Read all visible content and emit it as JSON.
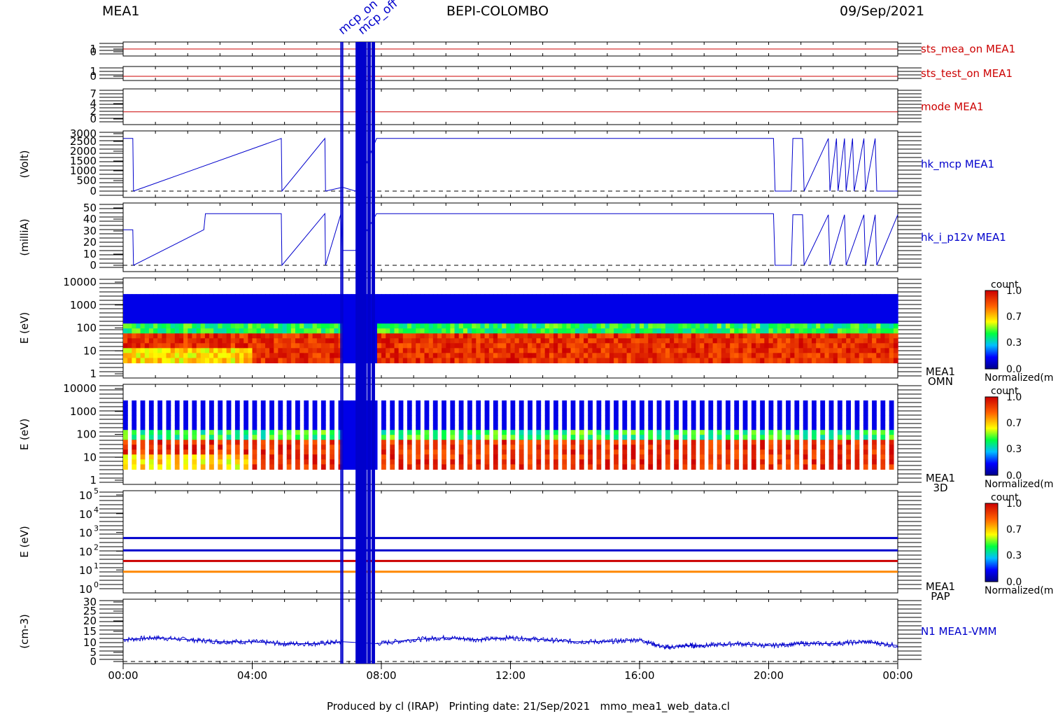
{
  "header": {
    "left": "MEA1",
    "center": "BEPI-COLOMBO",
    "right": "09/Sep/2021"
  },
  "footer": "Produced by cl (IRAP)   Printing date: 21/Sep/2021   mmo_mea1_web_data.cl",
  "colors": {
    "red": "#cc0000",
    "blue": "#0000cc",
    "black": "#000000"
  },
  "event_labels": [
    "mcp_on",
    "mcp_off"
  ],
  "time_axis": {
    "start_hour": 0,
    "end_hour": 24,
    "ticks": [
      "00:00",
      "04:00",
      "08:00",
      "12:00",
      "16:00",
      "20:00",
      "00:00"
    ]
  },
  "colorbar": {
    "title": "count",
    "ticks": [
      "1.0",
      "0.7",
      "0.3",
      "0.0"
    ],
    "label": "Normalized(m"
  },
  "chart_data": [
    {
      "type": "line",
      "name": "sts_mea_on MEA1",
      "ylim": [
        0,
        1
      ],
      "yticks": [
        "1",
        "0"
      ],
      "series": [
        {
          "name": "sts_mea_on MEA1",
          "x": [
            0,
            24
          ],
          "y": [
            1,
            1
          ]
        }
      ]
    },
    {
      "type": "line",
      "name": "sts_test_on MEA1",
      "ylim": [
        0,
        1
      ],
      "yticks": [
        "1",
        "0"
      ],
      "series": [
        {
          "name": "sts_test_on MEA1",
          "x": [
            0,
            24
          ],
          "y": [
            0,
            0
          ]
        }
      ]
    },
    {
      "type": "line",
      "name": "mode MEA1",
      "ylim": [
        0,
        7
      ],
      "yticks": [
        "7",
        "4",
        "2",
        "0"
      ],
      "series": [
        {
          "name": "mode MEA1",
          "x": [
            0,
            24
          ],
          "y": [
            2,
            2
          ]
        }
      ]
    },
    {
      "type": "line",
      "name": "hk_mcp MEA1",
      "ylabel": "(Volt)",
      "ylim": [
        0,
        3000
      ],
      "yticks": [
        "3000",
        "2500",
        "2000",
        "1500",
        "1000",
        "500",
        "0"
      ],
      "series": [
        {
          "name": "hk_mcp MEA1",
          "x": [
            0,
            0.3,
            0.32,
            4.9,
            4.92,
            6.25,
            6.27,
            6.8,
            7.2,
            7.85,
            20.15,
            20.2,
            20.7,
            20.75,
            21.05,
            21.1,
            21.85,
            21.9,
            22.1,
            22.15,
            22.35,
            22.4,
            22.6,
            22.65,
            22.95,
            23.0,
            23.3,
            23.35,
            24
          ],
          "y": [
            2750,
            2750,
            0,
            2750,
            0,
            2750,
            0,
            200,
            0,
            2750,
            2750,
            0,
            0,
            2750,
            2750,
            0,
            2750,
            0,
            2750,
            0,
            2750,
            0,
            2750,
            0,
            2750,
            0,
            2750,
            0,
            0
          ]
        }
      ]
    },
    {
      "type": "line",
      "name": "hk_i_p12v MEA1",
      "ylabel": "(milliA)",
      "ylim": [
        0,
        50
      ],
      "yticks": [
        "50",
        "40",
        "30",
        "20",
        "10",
        "0"
      ],
      "series": [
        {
          "name": "hk_i_p12v MEA1",
          "x": [
            0,
            0.3,
            0.32,
            2.5,
            2.55,
            4.9,
            4.92,
            6.25,
            6.27,
            6.75,
            6.8,
            7.2,
            7.85,
            20.15,
            20.2,
            20.7,
            20.75,
            21.05,
            21.1,
            21.85,
            21.9,
            22.35,
            22.4,
            22.95,
            23.0,
            23.3,
            23.35,
            24
          ],
          "y": [
            31,
            31,
            0,
            31,
            45,
            45,
            0,
            45,
            0,
            45,
            13,
            13,
            45,
            45,
            0,
            0,
            44,
            44,
            0,
            44,
            0,
            44,
            0,
            44,
            0,
            44,
            0,
            44
          ]
        }
      ]
    },
    {
      "type": "heatmap",
      "name": "MEA1 OMN",
      "ylabel": "E (eV)",
      "ylim": [
        1,
        10000
      ],
      "yticks": [
        "10000",
        "1000",
        "100",
        "10",
        "1"
      ],
      "label_lines": [
        "MEA1",
        "OMN"
      ],
      "erange": [
        3,
        3000
      ]
    },
    {
      "type": "heatmap",
      "name": "MEA1 3D",
      "ylabel": "E (eV)",
      "ylim": [
        1,
        10000
      ],
      "yticks": [
        "10000",
        "1000",
        "100",
        "10",
        "1"
      ],
      "label_lines": [
        "MEA1",
        "3D"
      ],
      "erange": [
        3,
        3000
      ]
    },
    {
      "type": "heatmap",
      "name": "MEA1 PAP",
      "ylabel": "E (eV)",
      "ylim": [
        1,
        100000
      ],
      "yticks": [
        "5",
        "4",
        "3",
        "2",
        "1",
        "0"
      ],
      "label_lines": [
        "MEA1",
        "PAP"
      ],
      "energy_lines": [
        500,
        110,
        30,
        8
      ]
    },
    {
      "type": "line",
      "name": "N1 MEA1-VMM",
      "ylabel": "(cm-3)",
      "ylim": [
        0,
        30
      ],
      "yticks": [
        "30",
        "25",
        "20",
        "15",
        "10",
        "5",
        "0"
      ],
      "series": [
        {
          "name": "N1 MEA1-VMM",
          "x": [
            0,
            1,
            2,
            3,
            4,
            5,
            6,
            6.8,
            7.85,
            9,
            10,
            11,
            12,
            13,
            14,
            15,
            16,
            16.8,
            17.5,
            18,
            19,
            20,
            21,
            22,
            23,
            24
          ],
          "y": [
            11,
            12,
            11,
            10,
            10,
            9,
            9,
            10,
            9,
            11,
            12,
            11,
            12,
            11,
            10,
            10,
            11,
            7,
            8,
            8,
            9,
            8,
            9,
            9,
            10,
            8
          ]
        }
      ]
    }
  ]
}
